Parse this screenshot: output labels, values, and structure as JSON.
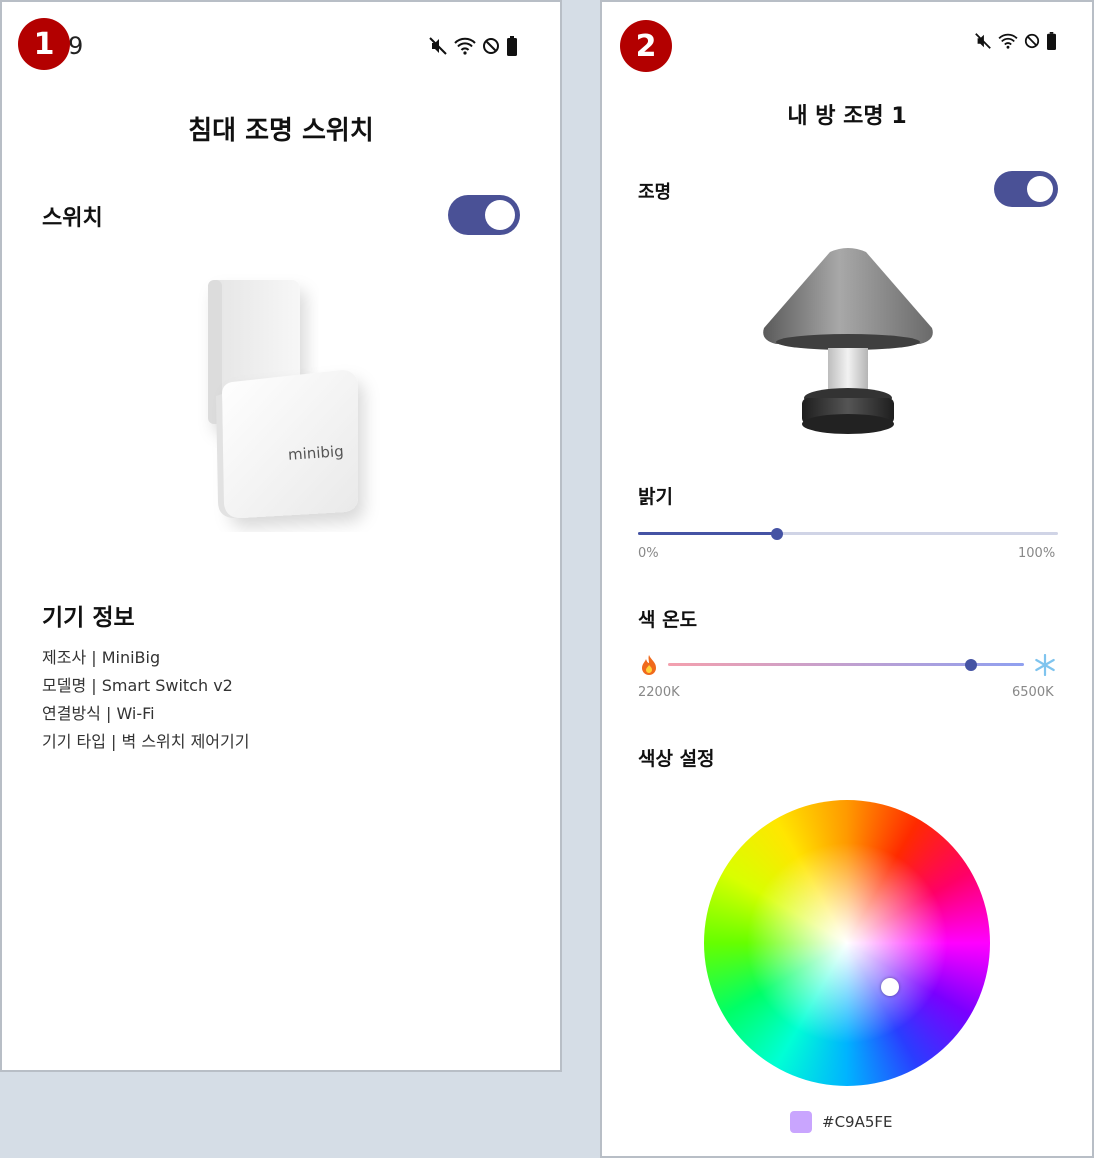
{
  "screen1": {
    "badge": "1",
    "status_time": "9",
    "title": "침대 조명 스위치",
    "switch_label": "스위치",
    "switch_on": true,
    "device_brand_text": "minibig",
    "info_title": "기기 정보",
    "info_lines": [
      "제조사 | MiniBig",
      "모델명 | Smart Switch v2",
      "연결방식 | Wi-Fi",
      "기기 타입 | 벽 스위치 제어기기"
    ]
  },
  "screen2": {
    "badge": "2",
    "title": "내 방 조명 1",
    "light_label": "조명",
    "light_on": true,
    "brightness_label": "밝기",
    "brightness_min": "0%",
    "brightness_max": "100%",
    "brightness_value_pct": 33,
    "color_temp_label": "색 온도",
    "color_temp_min": "2200K",
    "color_temp_max": "6500K",
    "color_temp_value_pct": 85,
    "color_label": "색상 설정",
    "selected_color_hex": "#C9A5FE",
    "selected_color_text": "#C9A5FE"
  },
  "colors": {
    "accent": "#4a5196",
    "badge": "#b30000"
  },
  "icons": {
    "status": [
      "mute-icon",
      "wifi-icon",
      "do-not-disturb-icon",
      "battery-icon"
    ],
    "color_temp_low": "fire-icon",
    "color_temp_high": "snowflake-icon"
  }
}
